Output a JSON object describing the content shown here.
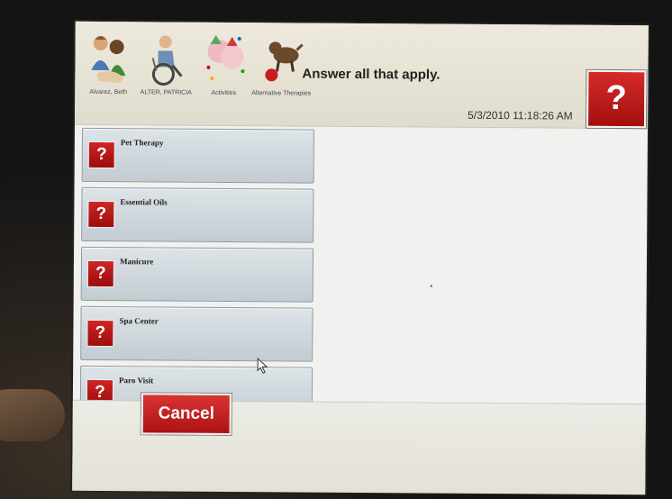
{
  "header": {
    "breadcrumbs": [
      {
        "label": "Alvarez, Beth",
        "icon": "residents-icon"
      },
      {
        "label": "ALTER, PATRICIA",
        "icon": "resident-wheelchair-icon"
      },
      {
        "label": "Activities",
        "icon": "activities-icon"
      },
      {
        "label": "Alternative Therapies",
        "icon": "therapy-dog-icon"
      }
    ],
    "instruction": "Answer all that apply.",
    "timestamp": "5/3/2010 11:18:26 AM",
    "help_label": "?"
  },
  "answers": [
    {
      "label": "Pet Therapy",
      "help": "?"
    },
    {
      "label": "Essential Oils",
      "help": "?"
    },
    {
      "label": "Manicure",
      "help": "?"
    },
    {
      "label": "Spa Center",
      "help": "?"
    },
    {
      "label": "Paro Visit",
      "help": "?"
    }
  ],
  "footer": {
    "cancel_label": "Cancel"
  },
  "colors": {
    "help_red": "#c01818",
    "answer_bg": "#d2d9dd",
    "screen_bg": "#f1f1ef"
  }
}
